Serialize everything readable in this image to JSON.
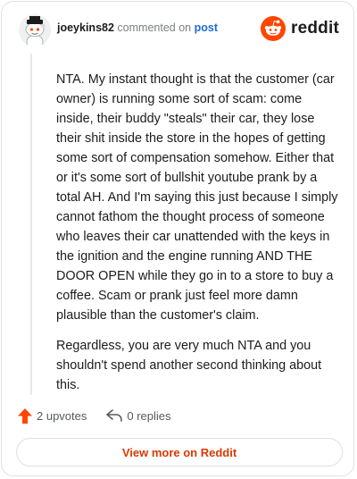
{
  "header": {
    "username": "joeykins82",
    "commented_text": "commented on",
    "post_link": "post",
    "brand_name": "reddit"
  },
  "comment": {
    "paragraphs": [
      "NTA. My instant thought is that the customer (car owner) is running some sort of scam: come inside, their buddy \"steals\" their car, they lose their shit inside the store in the hopes of getting some sort of compensation somehow. Either that or it's some sort of bullshit youtube prank by a total AH. And I'm saying this just because I simply cannot fathom the thought process of someone who leaves their car unattended with the keys in the ignition and the engine running AND THE DOOR OPEN while they go in to a store to buy a coffee. Scam or prank just feel more damn plausible than the customer's claim.",
      "Regardless, you are very much NTA and you shouldn't spend another second thinking about this."
    ]
  },
  "actions": {
    "upvotes": "2 upvotes",
    "replies": "0 replies"
  },
  "view_more_label": "View more on Reddit",
  "colors": {
    "accent": "#ff4500",
    "link": "#1b6cd6",
    "view_more": "#d93a00"
  },
  "icons": {
    "avatar": "snoo-avatar-icon",
    "brand": "reddit-logo-icon",
    "upvote": "upvote-arrow-icon",
    "reply": "reply-arrow-icon"
  }
}
